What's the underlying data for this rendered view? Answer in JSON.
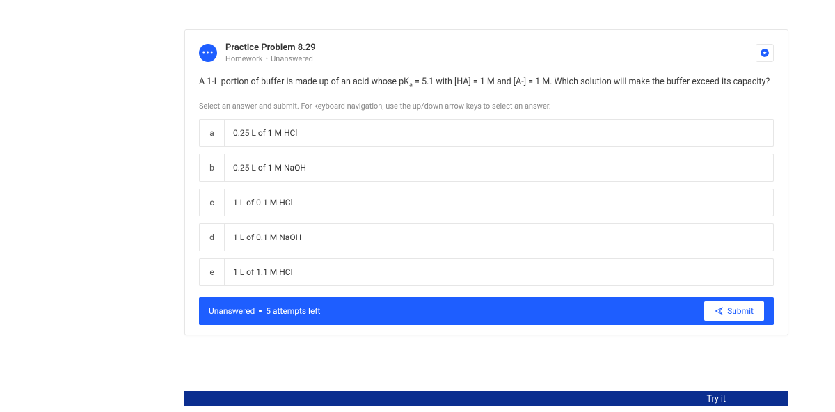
{
  "header": {
    "title": "Practice Problem 8.29",
    "category": "Homework",
    "status": "Unanswered"
  },
  "question": {
    "pre": "A 1-L portion of buffer is made up of an acid whose pK",
    "sub": "a",
    "post": " = 5.1 with [HA] = 1 M and [A-] = 1 M. Which solution will make the buffer exceed its capacity?"
  },
  "instruction": "Select an answer and submit. For keyboard navigation, use the up/down arrow keys to select an answer.",
  "options": [
    {
      "key": "a",
      "text": "0.25 L of 1 M HCl"
    },
    {
      "key": "b",
      "text": "0.25 L of 1 M NaOH"
    },
    {
      "key": "c",
      "text": "1 L of 0.1 M HCl"
    },
    {
      "key": "d",
      "text": "1 L of 0.1 M NaOH"
    },
    {
      "key": "e",
      "text": "1 L of 1.1 M HCl"
    }
  ],
  "footer": {
    "status": "Unanswered",
    "attempts": "5 attempts left",
    "submit_label": "Submit"
  },
  "tryit": "Try it"
}
